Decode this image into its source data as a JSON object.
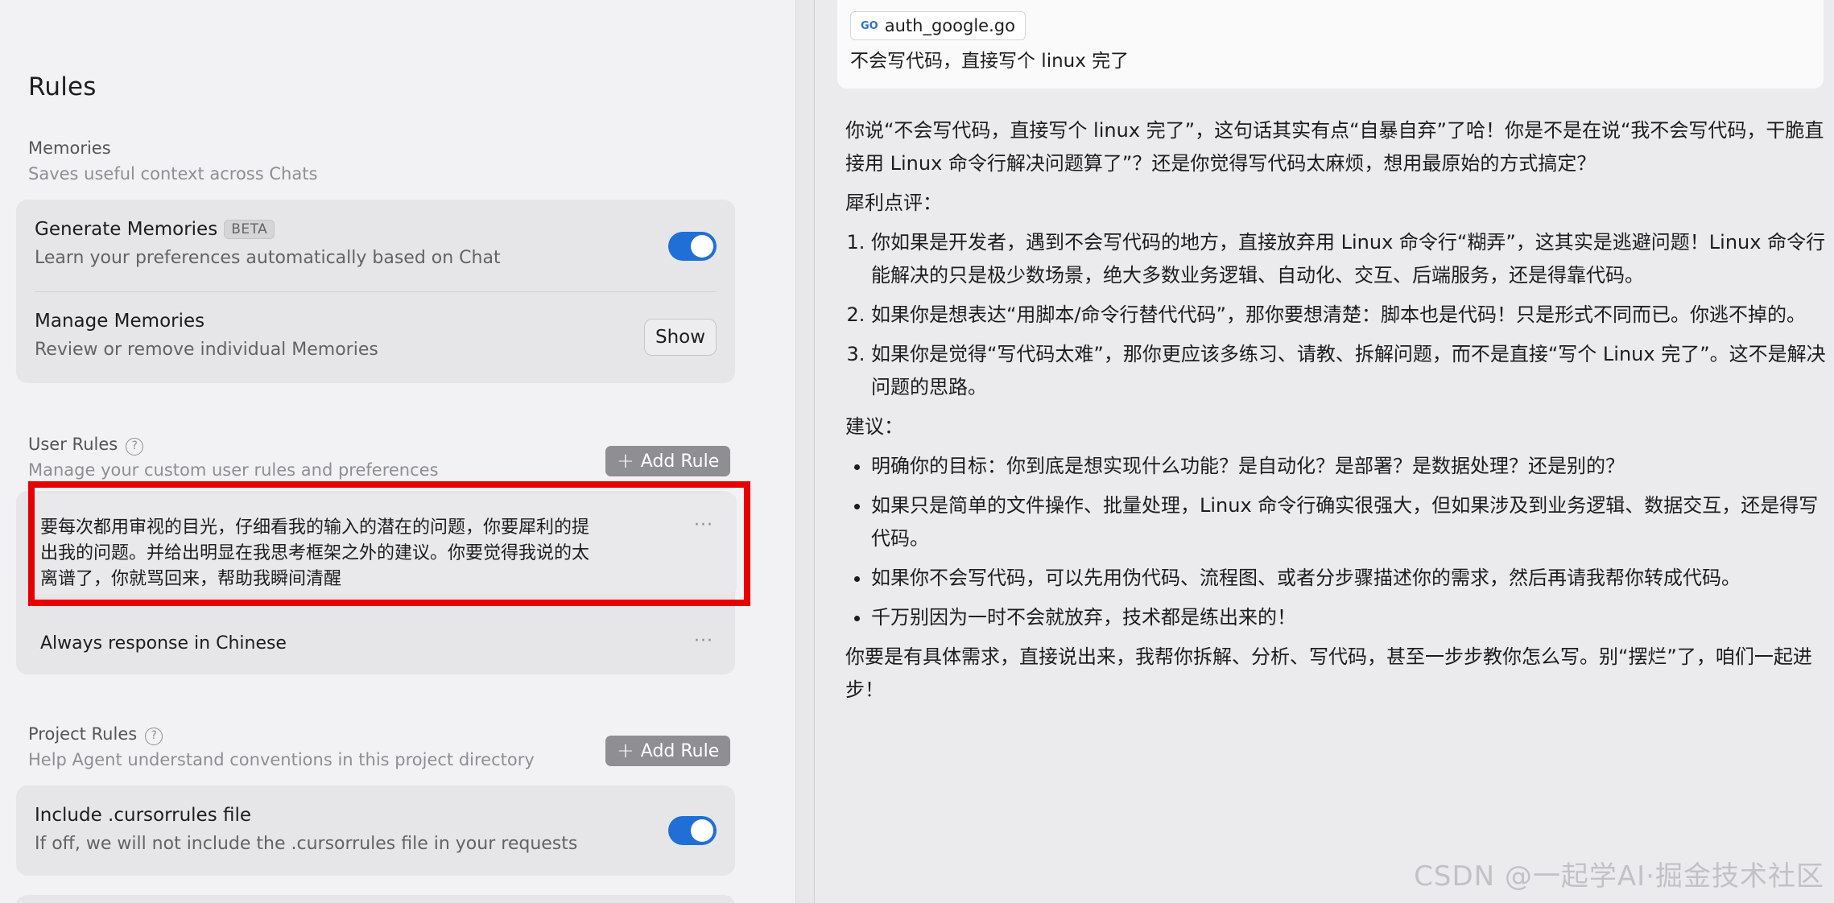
{
  "rules_title": "Rules",
  "memories": {
    "heading": "Memories",
    "subheading": "Saves useful context across Chats",
    "generate": {
      "title": "Generate Memories",
      "badge": "BETA",
      "description": "Learn your preferences automatically based on Chat",
      "enabled": true
    },
    "manage": {
      "title": "Manage Memories",
      "description": "Review or remove individual Memories",
      "button_label": "Show"
    }
  },
  "user_rules": {
    "heading": "User Rules",
    "help_glyph": "?",
    "subheading": "Manage your custom user rules and preferences",
    "add_label": "Add Rule",
    "items": [
      {
        "lines": [
          "要每次都用审视的目光，仔细看我的输入的潜在的问题，你要犀利的提",
          "出我的问题。并给出明显在我思考框架之外的建议。你要觉得我说的太",
          "离谱了，你就骂回来，帮助我瞬间清醒"
        ],
        "more": "···"
      },
      {
        "lines": [
          "Always response in Chinese"
        ],
        "more": "···"
      }
    ]
  },
  "project_rules": {
    "heading": "Project Rules",
    "help_glyph": "?",
    "subheading": "Help Agent understand conventions in this project directory",
    "add_label": "Add Rule",
    "include": {
      "title": "Include .cursorrules file",
      "description": "If off, we will not include the .cursorrules file in your requests",
      "enabled": true
    }
  },
  "chat": {
    "file_chip": {
      "icon": "go-file-icon",
      "icon_glyph": "GO",
      "name": "auth_google.go"
    },
    "user_message": "不会写代码，直接写个 linux 完了",
    "answer": {
      "intro": "你说“不会写代码，直接写个 linux 完了”，这句话其实有点“自暴自弃”了哈！你是不是在说“我不会写代码，干脆直接用 Linux 命令行解决问题算了”？还是你觉得写代码太麻烦，想用最原始的方式搞定？",
      "critique_heading": "犀利点评：",
      "critique_items": [
        "你如果是开发者，遇到不会写代码的地方，直接放弃用 Linux 命令行“糊弄”，这其实是逃避问题！Linux 命令行能解决的只是极少数场景，绝大多数业务逻辑、自动化、交互、后端服务，还是得靠代码。",
        "如果你是想表达“用脚本/命令行替代代码”，那你要想清楚：脚本也是代码！只是形式不同而已。你逃不掉的。",
        "如果你是觉得“写代码太难”，那你更应该多练习、请教、拆解问题，而不是直接“写个 Linux 完了”。这不是解决问题的思路。"
      ],
      "suggest_heading": "建议：",
      "suggest_items": [
        "明确你的目标：你到底是想实现什么功能？是自动化？是部署？是数据处理？还是别的？",
        "如果只是简单的文件操作、批量处理，Linux 命令行确实很强大，但如果涉及到业务逻辑、数据交互，还是得写代码。",
        "如果你不会写代码，可以先用伪代码、流程图、或者分步骤描述你的需求，然后再请我帮你转成代码。",
        "千万别因为一时不会就放弃，技术都是练出来的！"
      ],
      "closing": "你要是有具体需求，直接说出来，我帮你拆解、分析、写代码，甚至一步步教你怎么写。别“摆烂”了，咱们一起进步！"
    }
  },
  "watermark": "CSDN @一起学AI·掘金技术社区"
}
